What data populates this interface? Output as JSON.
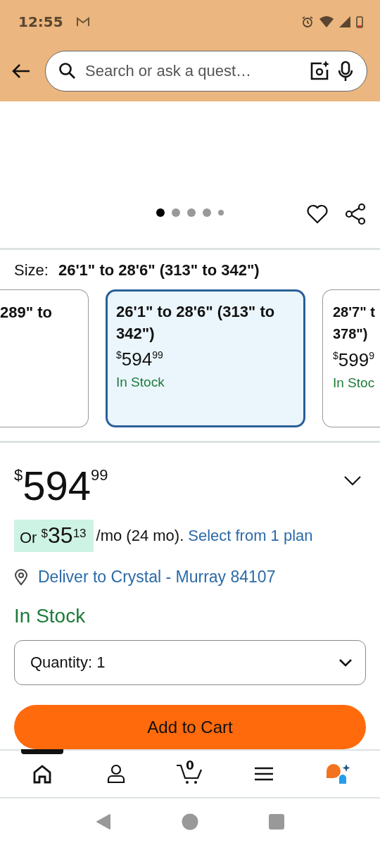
{
  "status_bar": {
    "time": "12:55"
  },
  "search": {
    "placeholder": "Search or ask a quest…"
  },
  "gallery": {
    "dots": [
      {
        "selected": true
      },
      {
        "selected": false
      },
      {
        "selected": false
      },
      {
        "selected": false
      },
      {
        "selected": false
      }
    ]
  },
  "size": {
    "label": "Size:",
    "value": "26'1\" to 28'6\" (313\" to 342\")"
  },
  "size_options": [
    {
      "title": "289\" to",
      "selected": false
    },
    {
      "title": "26'1\" to 28'6\" (313\" to 342\")",
      "currency": "$",
      "whole": "594",
      "cents": "99",
      "availability": "In Stock",
      "selected": true
    },
    {
      "title": "28'7\" t 378\")",
      "currency": "$",
      "whole": "599",
      "cents": "9",
      "availability": "In Stoc",
      "selected": false
    }
  ],
  "price": {
    "currency": "$",
    "whole": "594",
    "cents": "99"
  },
  "financing": {
    "prefix": "Or",
    "currency": "$",
    "whole": "35",
    "cents": "13",
    "terms": "/mo (24 mo).",
    "link": "Select from 1 plan"
  },
  "delivery": "Deliver to Crystal - Murray 84107",
  "availability": "In Stock",
  "quantity": "Quantity: 1",
  "add_to_cart": "Add to Cart",
  "bottom_nav": [
    {
      "kind": "home",
      "selected": true
    },
    {
      "kind": "account",
      "selected": false
    },
    {
      "kind": "cart",
      "badge": "0",
      "selected": false
    },
    {
      "kind": "menu",
      "selected": false
    },
    {
      "kind": "assistant",
      "selected": false
    }
  ]
}
